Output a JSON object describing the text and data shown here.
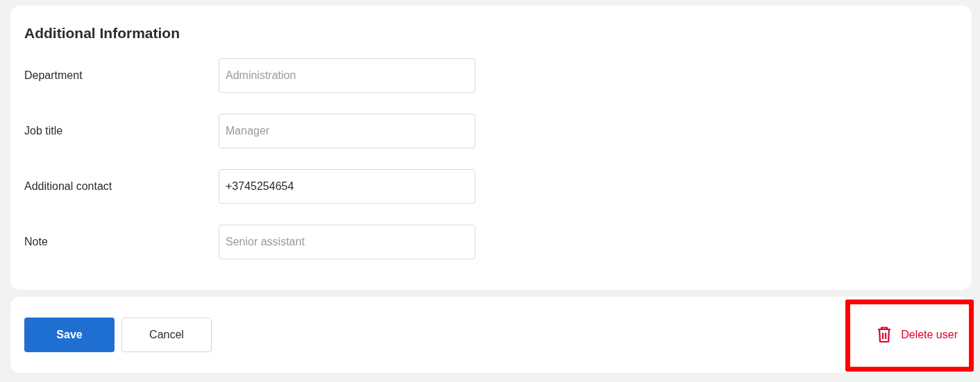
{
  "section": {
    "title": "Additional Information",
    "fields": [
      {
        "label": "Department",
        "placeholder": "Administration"
      },
      {
        "label": "Job title",
        "placeholder": "Manager"
      },
      {
        "label": "Additional contact",
        "value": "+3745254654"
      },
      {
        "label": "Note",
        "placeholder": "Senior assistant"
      }
    ]
  },
  "actions": {
    "buttons": [
      {
        "label": "Save",
        "kind": "primary"
      },
      {
        "label": "Cancel",
        "kind": "secondary"
      }
    ],
    "delete": {
      "label": "Delete user",
      "highlighted": true
    }
  }
}
